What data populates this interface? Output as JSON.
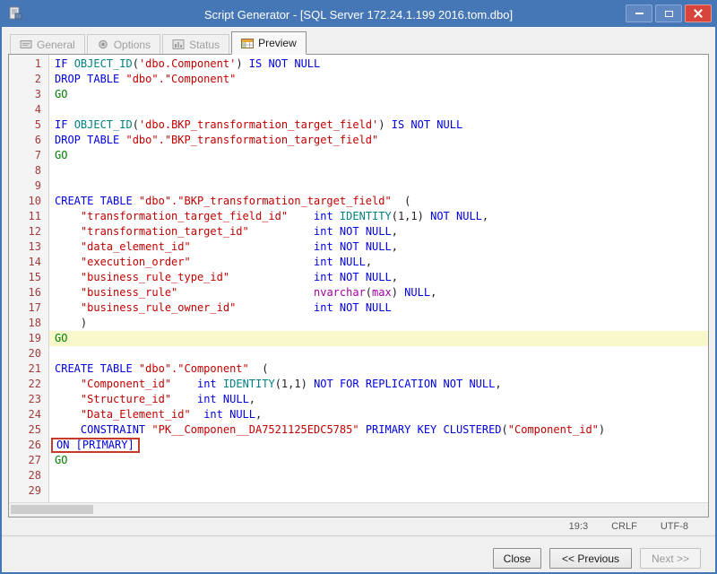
{
  "colors": {
    "titlebar": "#4576b5",
    "window_border": "#3a6aa8",
    "close_button": "#d8453c",
    "kw": "#0000dd",
    "id": "#c00000",
    "str": "#c00000",
    "go": "#008000",
    "fn": "#008080",
    "ty": "#a000a0",
    "num": "#222222",
    "pl": "#1a1a1a",
    "linenum": "#a03c3c",
    "hl": "#f8f8cb",
    "annotation": "#c53a2a"
  },
  "window": {
    "title": "Script Generator - [SQL Server 172.24.1.199 2016.tom.dbo]"
  },
  "tabs": [
    {
      "label": "General",
      "icon": "wizard-icon",
      "enabled": false,
      "active": false
    },
    {
      "label": "Options",
      "icon": "options-gear-icon",
      "enabled": false,
      "active": false
    },
    {
      "label": "Status",
      "icon": "status-icon",
      "enabled": false,
      "active": false
    },
    {
      "label": "Preview",
      "icon": "preview-table-icon",
      "enabled": true,
      "active": true
    }
  ],
  "editor": {
    "current_line": 19,
    "lines": [
      {
        "n": 1,
        "t": [
          [
            "kw",
            "IF "
          ],
          [
            "fn",
            "OBJECT_ID"
          ],
          [
            "pl",
            "("
          ],
          [
            "str",
            "'dbo.Component'"
          ],
          [
            "pl",
            ")"
          ],
          [
            "kw",
            " IS NOT NULL"
          ]
        ]
      },
      {
        "n": 2,
        "t": [
          [
            "kw",
            "DROP TABLE "
          ],
          [
            "id",
            "\"dbo\".\"Component\""
          ]
        ]
      },
      {
        "n": 3,
        "t": [
          [
            "go",
            "GO"
          ]
        ]
      },
      {
        "n": 4,
        "t": []
      },
      {
        "n": 5,
        "t": [
          [
            "kw",
            "IF "
          ],
          [
            "fn",
            "OBJECT_ID"
          ],
          [
            "pl",
            "("
          ],
          [
            "str",
            "'dbo.BKP_transformation_target_field'"
          ],
          [
            "pl",
            ")"
          ],
          [
            "kw",
            " IS NOT NULL"
          ]
        ]
      },
      {
        "n": 6,
        "t": [
          [
            "kw",
            "DROP TABLE "
          ],
          [
            "id",
            "\"dbo\".\"BKP_transformation_target_field\""
          ]
        ]
      },
      {
        "n": 7,
        "t": [
          [
            "go",
            "GO"
          ]
        ]
      },
      {
        "n": 8,
        "t": []
      },
      {
        "n": 9,
        "t": []
      },
      {
        "n": 10,
        "t": [
          [
            "kw",
            "CREATE TABLE "
          ],
          [
            "id",
            "\"dbo\".\"BKP_transformation_target_field\""
          ],
          [
            "pl",
            "  ("
          ]
        ]
      },
      {
        "n": 11,
        "t": [
          [
            "pl",
            "    "
          ],
          [
            "id",
            "\"transformation_target_field_id\""
          ],
          [
            "pl",
            "    "
          ],
          [
            "kw",
            "int"
          ],
          [
            "pl",
            " "
          ],
          [
            "fn",
            "IDENTITY"
          ],
          [
            "pl",
            "("
          ],
          [
            "num",
            "1,1"
          ],
          [
            "pl",
            ") "
          ],
          [
            "kw",
            "NOT NULL"
          ],
          [
            "pl",
            ","
          ]
        ]
      },
      {
        "n": 12,
        "t": [
          [
            "pl",
            "    "
          ],
          [
            "id",
            "\"transformation_target_id\""
          ],
          [
            "pl",
            "          "
          ],
          [
            "kw",
            "int"
          ],
          [
            "pl",
            " "
          ],
          [
            "kw",
            "NOT NULL"
          ],
          [
            "pl",
            ","
          ]
        ]
      },
      {
        "n": 13,
        "t": [
          [
            "pl",
            "    "
          ],
          [
            "id",
            "\"data_element_id\""
          ],
          [
            "pl",
            "                   "
          ],
          [
            "kw",
            "int"
          ],
          [
            "pl",
            " "
          ],
          [
            "kw",
            "NOT NULL"
          ],
          [
            "pl",
            ","
          ]
        ]
      },
      {
        "n": 14,
        "t": [
          [
            "pl",
            "    "
          ],
          [
            "id",
            "\"execution_order\""
          ],
          [
            "pl",
            "                   "
          ],
          [
            "kw",
            "int"
          ],
          [
            "pl",
            " "
          ],
          [
            "kw",
            "NULL"
          ],
          [
            "pl",
            ","
          ]
        ]
      },
      {
        "n": 15,
        "t": [
          [
            "pl",
            "    "
          ],
          [
            "id",
            "\"business_rule_type_id\""
          ],
          [
            "pl",
            "             "
          ],
          [
            "kw",
            "int"
          ],
          [
            "pl",
            " "
          ],
          [
            "kw",
            "NOT NULL"
          ],
          [
            "pl",
            ","
          ]
        ]
      },
      {
        "n": 16,
        "t": [
          [
            "pl",
            "    "
          ],
          [
            "id",
            "\"business_rule\""
          ],
          [
            "pl",
            "                     "
          ],
          [
            "ty",
            "nvarchar"
          ],
          [
            "pl",
            "("
          ],
          [
            "ty",
            "max"
          ],
          [
            "pl",
            ") "
          ],
          [
            "kw",
            "NULL"
          ],
          [
            "pl",
            ","
          ]
        ]
      },
      {
        "n": 17,
        "t": [
          [
            "pl",
            "    "
          ],
          [
            "id",
            "\"business_rule_owner_id\""
          ],
          [
            "pl",
            "            "
          ],
          [
            "kw",
            "int"
          ],
          [
            "pl",
            " "
          ],
          [
            "kw",
            "NOT NULL"
          ]
        ]
      },
      {
        "n": 18,
        "t": [
          [
            "pl",
            "    )"
          ]
        ]
      },
      {
        "n": 19,
        "hl": true,
        "t": [
          [
            "go",
            "GO"
          ]
        ]
      },
      {
        "n": 20,
        "t": []
      },
      {
        "n": 21,
        "t": [
          [
            "kw",
            "CREATE TABLE "
          ],
          [
            "id",
            "\"dbo\".\"Component\""
          ],
          [
            "pl",
            "  ("
          ]
        ]
      },
      {
        "n": 22,
        "t": [
          [
            "pl",
            "    "
          ],
          [
            "id",
            "\"Component_id\""
          ],
          [
            "pl",
            "    "
          ],
          [
            "kw",
            "int"
          ],
          [
            "pl",
            " "
          ],
          [
            "fn",
            "IDENTITY"
          ],
          [
            "pl",
            "("
          ],
          [
            "num",
            "1,1"
          ],
          [
            "pl",
            ") "
          ],
          [
            "kw",
            "NOT FOR REPLICATION NOT NULL"
          ],
          [
            "pl",
            ","
          ]
        ]
      },
      {
        "n": 23,
        "t": [
          [
            "pl",
            "    "
          ],
          [
            "id",
            "\"Structure_id\""
          ],
          [
            "pl",
            "    "
          ],
          [
            "kw",
            "int"
          ],
          [
            "pl",
            " "
          ],
          [
            "kw",
            "NULL"
          ],
          [
            "pl",
            ","
          ]
        ]
      },
      {
        "n": 24,
        "t": [
          [
            "pl",
            "    "
          ],
          [
            "id",
            "\"Data_Element_id\""
          ],
          [
            "pl",
            "  "
          ],
          [
            "kw",
            "int"
          ],
          [
            "pl",
            " "
          ],
          [
            "kw",
            "NULL"
          ],
          [
            "pl",
            ","
          ]
        ]
      },
      {
        "n": 25,
        "t": [
          [
            "pl",
            "    "
          ],
          [
            "kw",
            "CONSTRAINT "
          ],
          [
            "id",
            "\"PK__Componen__DA7521125EDC5785\""
          ],
          [
            "pl",
            " "
          ],
          [
            "kw",
            "PRIMARY KEY CLUSTERED"
          ],
          [
            "pl",
            "("
          ],
          [
            "id",
            "\"Component_id\""
          ],
          [
            "pl",
            ")"
          ]
        ]
      },
      {
        "n": 26,
        "box": true,
        "t": [
          [
            "kw",
            "ON [PRIMARY]"
          ]
        ]
      },
      {
        "n": 27,
        "t": [
          [
            "go",
            "GO"
          ]
        ]
      },
      {
        "n": 28,
        "t": []
      },
      {
        "n": 29,
        "t": []
      }
    ]
  },
  "statusbar": {
    "position": "19:3",
    "eol": "CRLF",
    "encoding": "UTF-8"
  },
  "footer": {
    "close_label": "Close",
    "previous_label": "<< Previous",
    "next_label": "Next >>"
  }
}
